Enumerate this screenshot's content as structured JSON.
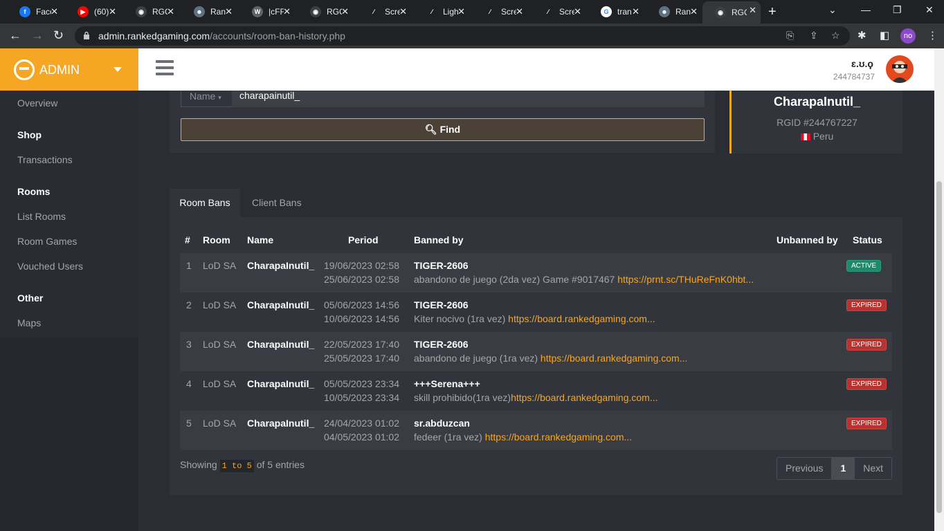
{
  "browser": {
    "tabs": [
      {
        "title": "Face",
        "icon": "facebook-icon",
        "color": "#1877f2",
        "glyph": "f"
      },
      {
        "title": "(60)",
        "icon": "youtube-icon",
        "color": "#ff0000",
        "glyph": "▶"
      },
      {
        "title": "RGC",
        "icon": "rgc-icon",
        "color": "#3c4043",
        "glyph": "◉"
      },
      {
        "title": "Ran",
        "icon": "ranked-icon",
        "color": "#607080",
        "glyph": "☻"
      },
      {
        "title": "|cFF",
        "icon": "wordpress-icon",
        "color": "#5f6368",
        "glyph": "W"
      },
      {
        "title": "RGC",
        "icon": "rgc-icon",
        "color": "#3c4043",
        "glyph": "◉"
      },
      {
        "title": "Scre",
        "icon": "feather-icon",
        "color": "#202124",
        "glyph": "⁄"
      },
      {
        "title": "Ligh",
        "icon": "feather-icon",
        "color": "#202124",
        "glyph": "⁄"
      },
      {
        "title": "Scre",
        "icon": "feather-icon",
        "color": "#202124",
        "glyph": "⁄"
      },
      {
        "title": "Scre",
        "icon": "feather-icon",
        "color": "#202124",
        "glyph": "⁄"
      },
      {
        "title": "tran",
        "icon": "google-icon",
        "color": "#ffffff",
        "glyph": "G"
      },
      {
        "title": "Ran",
        "icon": "ranked-icon",
        "color": "#607080",
        "glyph": "☻"
      },
      {
        "title": "RGC",
        "icon": "rgc-icon",
        "color": "#3c4043",
        "glyph": "◉"
      }
    ],
    "url_host": "admin.rankedgaming.com",
    "url_path": "/accounts/room-ban-history.php",
    "profile_initials": "no"
  },
  "brand": {
    "label": "ADMIN"
  },
  "sidebar": {
    "items": [
      {
        "type": "item",
        "label": "Overview"
      },
      {
        "type": "head",
        "label": "Shop"
      },
      {
        "type": "item",
        "label": "Transactions"
      },
      {
        "type": "head",
        "label": "Rooms"
      },
      {
        "type": "item",
        "label": "List Rooms"
      },
      {
        "type": "item",
        "label": "Room Games"
      },
      {
        "type": "item",
        "label": "Vouched Users"
      },
      {
        "type": "head",
        "label": "Other"
      },
      {
        "type": "item",
        "label": "Maps"
      }
    ]
  },
  "header": {
    "user_name": "ɛ.ʊ.ϙ",
    "user_id": "244784737"
  },
  "search": {
    "field_label": "Name",
    "value": "charapainutil_",
    "find_label": "Find"
  },
  "player": {
    "name": "CharapaInutil_",
    "rgid": "RGID #244767227",
    "country": "Peru"
  },
  "tabs": {
    "room_bans": "Room Bans",
    "client_bans": "Client Bans"
  },
  "table": {
    "headers": {
      "num": "#",
      "room": "Room",
      "name": "Name",
      "period": "Period",
      "banned_by": "Banned by",
      "unbanned_by": "Unbanned by",
      "status": "Status"
    },
    "rows": [
      {
        "num": "1",
        "room": "LoD SA",
        "name": "CharapaInutil_",
        "from": "19/06/2023 02:58",
        "to": "25/06/2023 02:58",
        "banned_by": "TIGER-2606",
        "reason": "abandono de juego (2da vez) Game #9017467 ",
        "link": "https://prnt.sc/THuReFnK0hbt...",
        "status": "ACTIVE"
      },
      {
        "num": "2",
        "room": "LoD SA",
        "name": "CharapaInutil_",
        "from": "05/06/2023 14:56",
        "to": "10/06/2023 14:56",
        "banned_by": "TIGER-2606",
        "reason": "Kiter nocivo (1ra vez) ",
        "link": "https://board.rankedgaming.com...",
        "status": "EXPIRED"
      },
      {
        "num": "3",
        "room": "LoD SA",
        "name": "CharapaInutil_",
        "from": "22/05/2023 17:40",
        "to": "25/05/2023 17:40",
        "banned_by": "TIGER-2606",
        "reason": "abandono de juego (1ra vez) ",
        "link": "https://board.rankedgaming.com...",
        "status": "EXPIRED"
      },
      {
        "num": "4",
        "room": "LoD SA",
        "name": "CharapaInutil_",
        "from": "05/05/2023 23:34",
        "to": "10/05/2023 23:34",
        "banned_by": "+++Serena+++",
        "reason": "skill prohibido(1ra vez)",
        "link": "https://board.rankedgaming.com...",
        "status": "EXPIRED"
      },
      {
        "num": "5",
        "room": "LoD SA",
        "name": "CharapaInutil_",
        "from": "24/04/2023 01:02",
        "to": "04/05/2023 01:02",
        "banned_by": "sr.abduzcan",
        "reason": "fedeer (1ra vez) ",
        "link": "https://board.rankedgaming.com...",
        "status": "EXPIRED"
      }
    ]
  },
  "footer": {
    "showing_prefix": "Showing",
    "range": "1 to 5",
    "showing_suffix": "of 5 entries"
  },
  "pagination": {
    "previous": "Previous",
    "current": "1",
    "next": "Next"
  },
  "colors": {
    "accent": "#f5a623",
    "active": "#1e8a6a",
    "expired": "#b8332f"
  }
}
